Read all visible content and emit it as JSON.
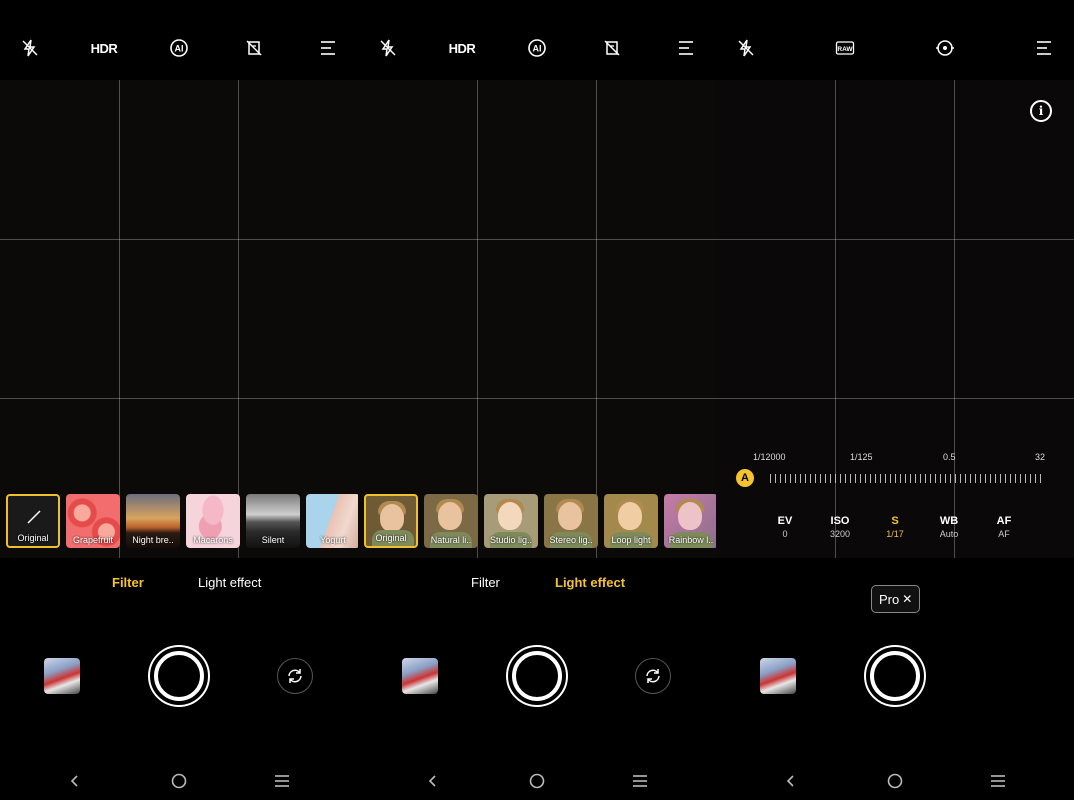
{
  "filter_panel": {
    "top_icons": [
      "flash-off-icon",
      "hdr-icon",
      "ai-icon",
      "tilt-shift-off-icon",
      "menu-icon"
    ],
    "hdr_label": "HDR",
    "filters": [
      {
        "name": "Original",
        "selected": true,
        "art": "pencil"
      },
      {
        "name": "Grapefruit",
        "art": "grapefruit"
      },
      {
        "name": "Night bre..",
        "art": "sunset"
      },
      {
        "name": "Macarons",
        "art": "macarons"
      },
      {
        "name": "Silent",
        "art": "mountain"
      },
      {
        "name": "Yogurt",
        "art": "building"
      }
    ],
    "tabs": {
      "filter": "Filter",
      "light_effect": "Light effect"
    },
    "active_tab": "Filter"
  },
  "light_panel": {
    "top_icons": [
      "flash-off-icon",
      "hdr-icon",
      "ai-icon",
      "tilt-shift-off-icon",
      "menu-icon"
    ],
    "hdr_label": "HDR",
    "effects": [
      {
        "name": "Original",
        "selected": true
      },
      {
        "name": "Natural li.."
      },
      {
        "name": "Studio lig.."
      },
      {
        "name": "Stereo lig.."
      },
      {
        "name": "Loop light"
      },
      {
        "name": "Rainbow l.."
      }
    ],
    "tabs": {
      "filter": "Filter",
      "light_effect": "Light effect"
    },
    "active_tab": "Light effect"
  },
  "pro_panel": {
    "top_icons": [
      "flash-off-icon",
      "raw-icon",
      "metering-icon",
      "menu-icon"
    ],
    "raw_label": "RAW",
    "info_label": "i",
    "scale_labels": [
      "1/12000",
      "1/125",
      "0.5",
      "32"
    ],
    "auto_badge": "A",
    "params": [
      {
        "name": "EV",
        "value": "0"
      },
      {
        "name": "ISO",
        "value": "3200"
      },
      {
        "name": "S",
        "value": "1/17",
        "active": true
      },
      {
        "name": "WB",
        "value": "Auto"
      },
      {
        "name": "AF",
        "value": "AF"
      }
    ],
    "mode_chip": "Pro",
    "mode_chip_close": "✕"
  },
  "nav_icons": [
    "back-icon",
    "home-icon",
    "recents-icon"
  ],
  "colors": {
    "accent": "#f5c332",
    "viewfinder": "#0c0909",
    "background": "#000000"
  }
}
